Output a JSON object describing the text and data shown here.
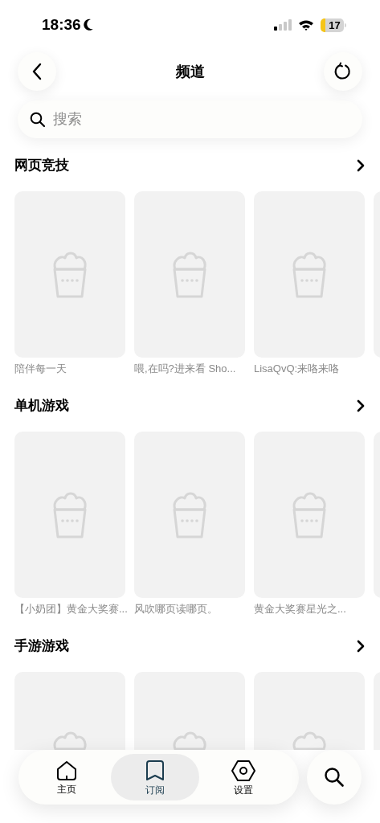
{
  "status_bar": {
    "time": "18:36",
    "battery": "17"
  },
  "header": {
    "title": "频道"
  },
  "search": {
    "placeholder": "搜索"
  },
  "sections": [
    {
      "title": "网页竞技",
      "items": [
        {
          "kind": "placeholder",
          "caption": "陪伴每一天"
        },
        {
          "kind": "placeholder",
          "caption": "喂,在吗?进来看 Sho..."
        },
        {
          "kind": "placeholder",
          "caption": "LisaQvQ:来咯来咯"
        },
        {
          "kind": "edge"
        }
      ]
    },
    {
      "title": "单机游戏",
      "items": [
        {
          "kind": "placeholder",
          "caption": "【小奶团】黄金大奖赛..."
        },
        {
          "kind": "placeholder",
          "caption": "风吹哪页读哪页。"
        },
        {
          "kind": "placeholder",
          "caption": "黄金大奖赛星光之..."
        },
        {
          "kind": "edge"
        }
      ]
    },
    {
      "title": "手游游戏",
      "items": [
        {
          "kind": "partial"
        },
        {
          "kind": "partial"
        },
        {
          "kind": "partial"
        },
        {
          "kind": "edge_partial"
        }
      ]
    }
  ],
  "tab_bar": [
    {
      "label": "主页",
      "selected": false
    },
    {
      "label": "订阅",
      "selected": true
    },
    {
      "label": "设置",
      "selected": false
    }
  ]
}
